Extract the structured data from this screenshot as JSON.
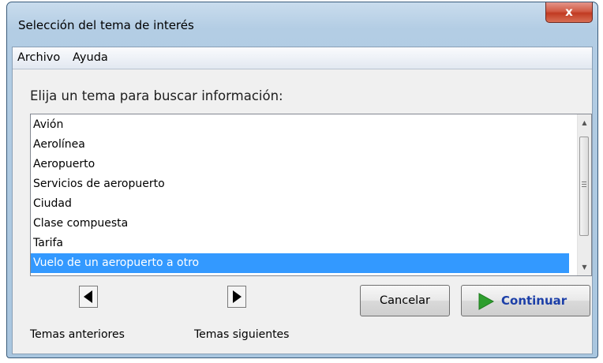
{
  "window": {
    "title": "Selección del tema de interés",
    "close_label": "x"
  },
  "menu": {
    "items": [
      "Archivo",
      "Ayuda"
    ]
  },
  "prompt": "Elija un tema para buscar información:",
  "topics": {
    "items": [
      "Avión",
      "Aerolínea",
      "Aeropuerto",
      "Servicios de aeropuerto",
      "Ciudad",
      "Clase compuesta",
      "Tarifa",
      "Vuelo de un aeropuerto a otro"
    ],
    "selected": "Vuelo de un aeropuerto a otro"
  },
  "navigation": {
    "previous_label": "Temas anteriores",
    "next_label": "Temas siguientes"
  },
  "buttons": {
    "cancel": "Cancelar",
    "continue": "Continuar"
  },
  "colors": {
    "selection": "#3399ff",
    "continue_text": "#1c3fa8",
    "continue_icon": "#2e9e2e",
    "close_button": "#c13b22"
  }
}
